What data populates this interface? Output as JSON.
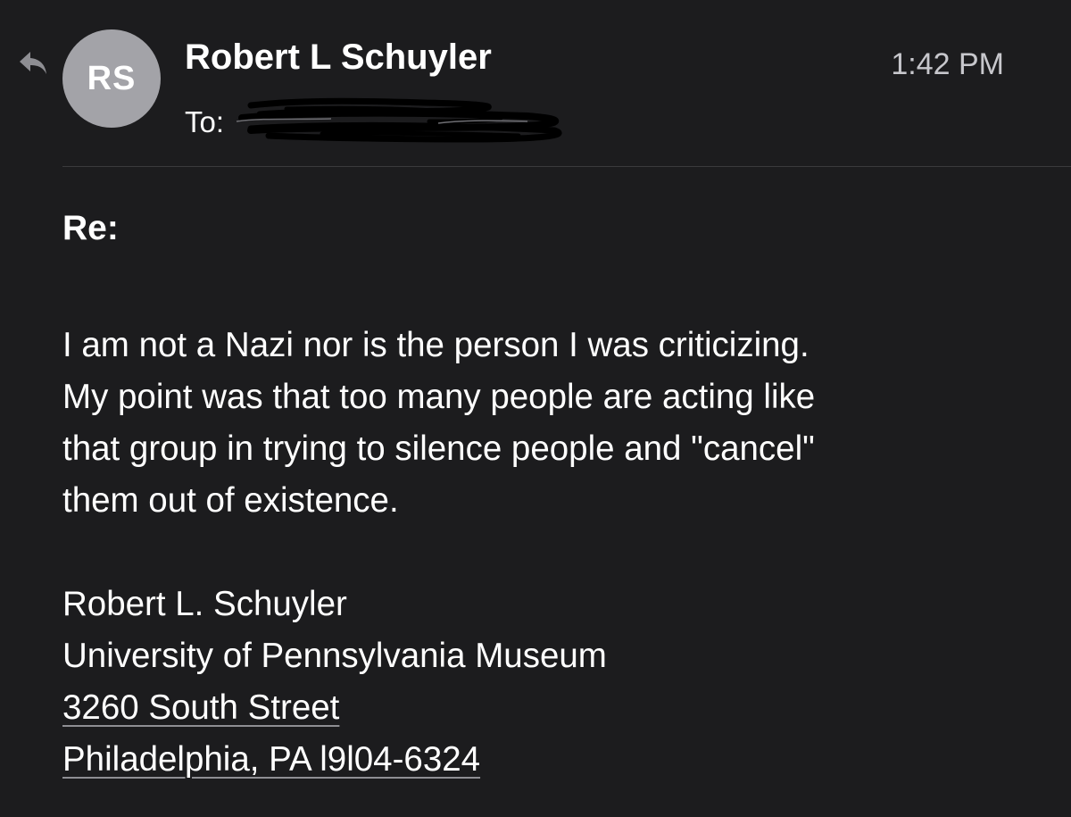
{
  "header": {
    "avatar_initials": "RS",
    "sender_name": "Robert L Schuyler",
    "to_label": "To:",
    "timestamp": "1:42 PM"
  },
  "icons": {
    "reply": "reply-arrow-icon"
  },
  "email": {
    "subject": "Re:",
    "body_lines": [
      "I am not a Nazi nor is the person I was criticizing.",
      "My point was that too many people are acting like",
      "that group in trying to silence people and \"cancel\"",
      "them out of existence."
    ],
    "signature": {
      "name": "Robert L. Schuyler",
      "organization": "University of Pennsylvania Museum",
      "street": "3260 South Street",
      "city": "Philadelphia, PA l9l04-6324"
    }
  },
  "colors": {
    "background": "#1c1c1e",
    "avatar": "#a3a3a8",
    "text": "#ffffff",
    "secondary_text": "#c7c7cc",
    "divider": "#3a3a3c"
  }
}
